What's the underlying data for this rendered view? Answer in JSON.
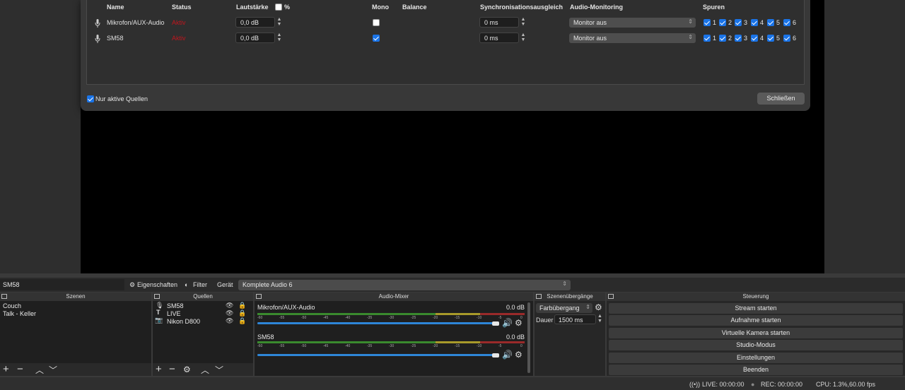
{
  "dialog": {
    "columns": {
      "name": "Name",
      "status": "Status",
      "volume": "Lautstärke",
      "percent": "%",
      "mono": "Mono",
      "balance": "Balance",
      "sync": "Synchronisationsausgleich",
      "monitoring": "Audio-Monitoring",
      "tracks": "Spuren"
    },
    "rows": [
      {
        "name": "Mikrofon/AUX-Audio",
        "status": "Aktiv",
        "volume": "0,0 dB",
        "mono": false,
        "sync": "0 ms",
        "monitoring": "Monitor aus",
        "tracks": [
          "1",
          "2",
          "3",
          "4",
          "5",
          "6"
        ]
      },
      {
        "name": "SM58",
        "status": "Aktiv",
        "volume": "0,0 dB",
        "mono": true,
        "sync": "0 ms",
        "monitoring": "Monitor aus",
        "tracks": [
          "1",
          "2",
          "3",
          "4",
          "5",
          "6"
        ]
      }
    ],
    "only_active_label": "Nur aktive Quellen",
    "close_label": "Schließen"
  },
  "propbar": {
    "source_name": "SM58",
    "properties_label": "Eigenschaften",
    "filter_label": "Filter",
    "device_label": "Gerät",
    "device_value": "Komplete Audio 6"
  },
  "scenes": {
    "title": "Szenen",
    "items": [
      "Couch",
      "Talk - Keller"
    ]
  },
  "sources": {
    "title": "Quellen",
    "items": [
      "SM58",
      "LIVE",
      "Nikon D800"
    ]
  },
  "mixer": {
    "title": "Audio-Mixer",
    "channels": [
      {
        "name": "Mikrofon/AUX-Audio",
        "db": "0.0 dB"
      },
      {
        "name": "SM58",
        "db": "0.0 dB"
      }
    ],
    "scale": [
      "-60",
      "-55",
      "-50",
      "-45",
      "-40",
      "-35",
      "-30",
      "-25",
      "-20",
      "-15",
      "-10",
      "-5",
      "0"
    ]
  },
  "transitions": {
    "title": "Szenenübergänge",
    "transition": "Farbübergang",
    "duration_label": "Dauer",
    "duration_value": "1500 ms"
  },
  "controls": {
    "title": "Steuerung",
    "buttons": [
      "Stream starten",
      "Aufnahme starten",
      "Virtuelle Kamera starten",
      "Studio-Modus",
      "Einstellungen",
      "Beenden"
    ]
  },
  "status": {
    "live": "LIVE: 00:00:00",
    "rec": "REC: 00:00:00",
    "cpu": "CPU: 1.3%,60.00 fps"
  },
  "colors": {
    "accent": "#1a74e8",
    "status_red": "#c0161d",
    "meter_green": "#3a8a2e",
    "meter_yellow": "#a89a2a",
    "meter_red": "#9a2a2a"
  }
}
